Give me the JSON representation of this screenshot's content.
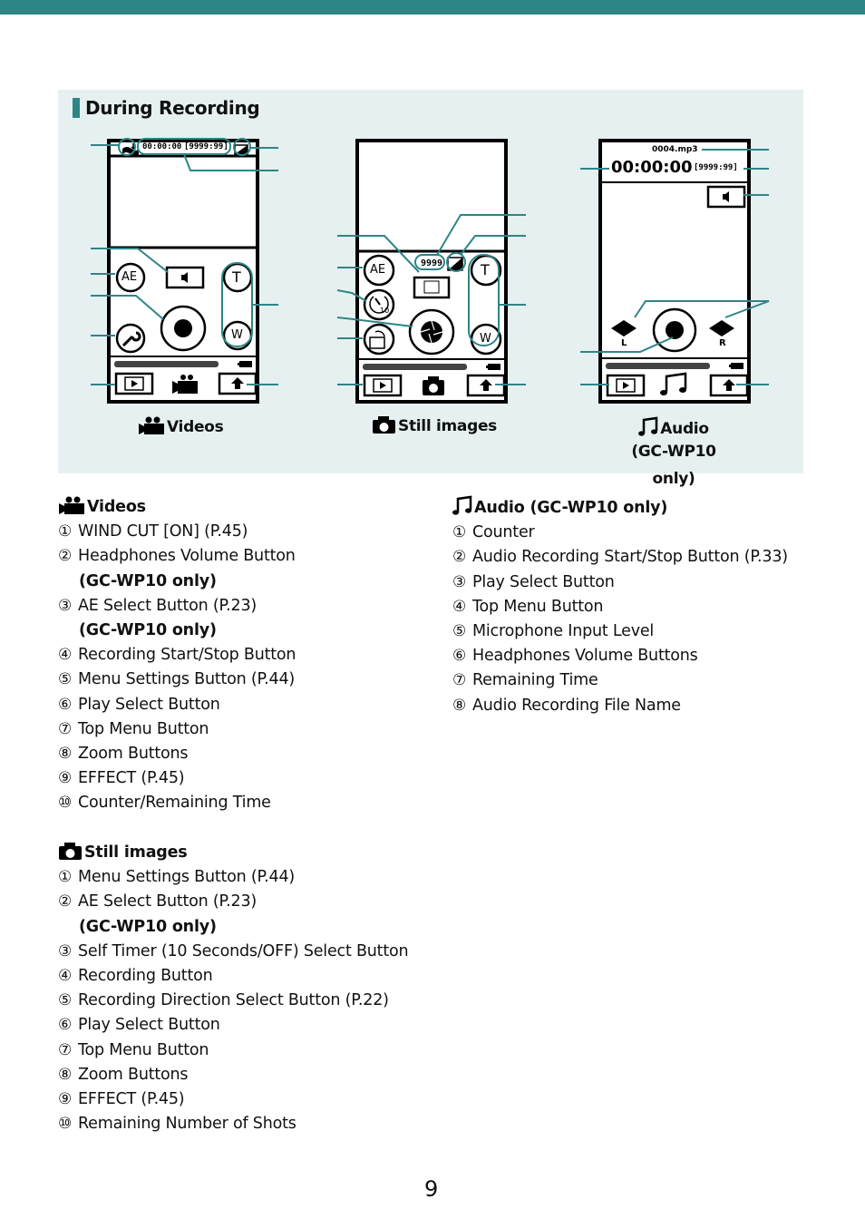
{
  "header": {
    "accent_color": "#2e8586"
  },
  "section_title": "During Recording",
  "diagrams": {
    "videos": {
      "caption": "Videos",
      "icon": "video-camera-icon",
      "counter": "00:00:00",
      "remaining": "[9999:99]",
      "zoom_t": "T",
      "zoom_w": "W",
      "ae_label": "AE"
    },
    "still": {
      "caption": "Still images",
      "icon": "camera-icon",
      "shots": "9999",
      "zoom_t": "T",
      "zoom_w": "W",
      "ae_label": "AE",
      "timer_label": "10"
    },
    "audio": {
      "caption": "Audio",
      "caption_sub": "(GC-WP10 only)",
      "icon": "music-note-icon",
      "filename": "0004.mp3",
      "counter": "00:00:00",
      "remaining": "[9999:99]",
      "left_label": "L",
      "right_label": "R"
    }
  },
  "legend": {
    "videos": {
      "title": "Videos",
      "items": [
        {
          "num": "①",
          "text": "WIND CUT [ON] (P.45)"
        },
        {
          "num": "②",
          "text": "Headphones Volume Button",
          "note": "(GC-WP10 only)"
        },
        {
          "num": "③",
          "text": "AE Select Button (P.23)",
          "note": "(GC-WP10 only)"
        },
        {
          "num": "④",
          "text": "Recording Start/Stop Button"
        },
        {
          "num": "⑤",
          "text": "Menu Settings Button (P.44)"
        },
        {
          "num": "⑥",
          "text": "Play Select Button"
        },
        {
          "num": "⑦",
          "text": "Top Menu Button"
        },
        {
          "num": "⑧",
          "text": "Zoom Buttons"
        },
        {
          "num": "⑨",
          "text": "EFFECT (P.45)"
        },
        {
          "num": "⑩",
          "text": "Counter/Remaining Time"
        }
      ]
    },
    "still": {
      "title": "Still images",
      "items": [
        {
          "num": "①",
          "text": "Menu Settings Button (P.44)"
        },
        {
          "num": "②",
          "text": "AE Select Button (P.23)",
          "note": "(GC-WP10 only)"
        },
        {
          "num": "③",
          "text": "Self Timer (10 Seconds/OFF) Select Button"
        },
        {
          "num": "④",
          "text": "Recording Button"
        },
        {
          "num": "⑤",
          "text": "Recording Direction Select Button (P.22)"
        },
        {
          "num": "⑥",
          "text": "Play Select Button"
        },
        {
          "num": "⑦",
          "text": "Top Menu Button"
        },
        {
          "num": "⑧",
          "text": "Zoom Buttons"
        },
        {
          "num": "⑨",
          "text": "EFFECT (P.45)"
        },
        {
          "num": "⑩",
          "text": "Remaining Number of Shots"
        }
      ]
    },
    "audio": {
      "title": "Audio (GC-WP10 only)",
      "items": [
        {
          "num": "①",
          "text": "Counter"
        },
        {
          "num": "②",
          "text": "Audio Recording Start/Stop Button (P.33)"
        },
        {
          "num": "③",
          "text": "Play Select Button"
        },
        {
          "num": "④",
          "text": "Top Menu Button"
        },
        {
          "num": "⑤",
          "text": "Microphone Input Level"
        },
        {
          "num": "⑥",
          "text": "Headphones Volume Buttons"
        },
        {
          "num": "⑦",
          "text": "Remaining Time"
        },
        {
          "num": "⑧",
          "text": "Audio Recording File Name"
        }
      ]
    }
  },
  "page_number": "9"
}
